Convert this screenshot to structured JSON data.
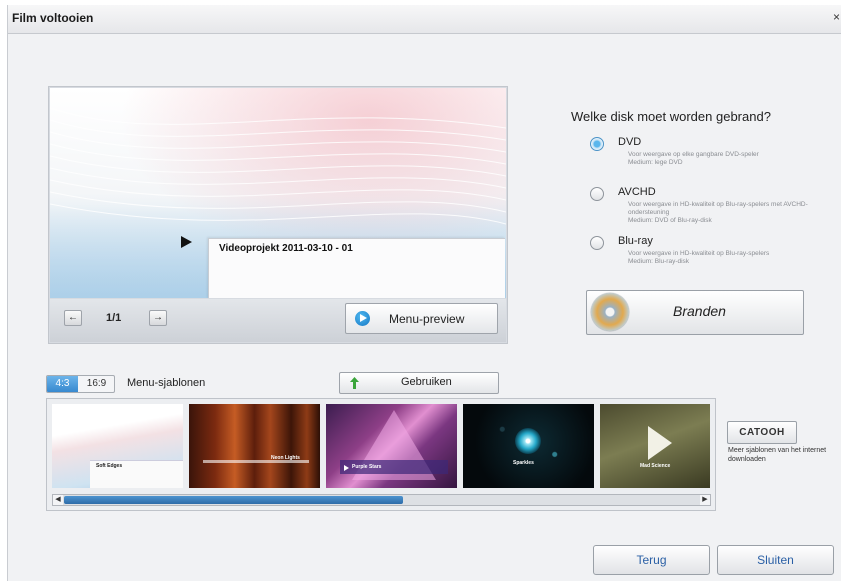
{
  "window": {
    "title": "Film voltooien",
    "close_glyph": "×"
  },
  "preview": {
    "project_title": "Videoprojekt 2011-03-10 - 01",
    "page_indicator": "1/1",
    "prev_icon": "arrow-left-icon",
    "next_icon": "arrow-right-icon",
    "menu_preview_label": "Menu-preview"
  },
  "disc": {
    "question": "Welke disk moet worden gebrand?",
    "options": [
      {
        "label": "DVD",
        "selected": true,
        "description": "Voor weergave op elke gangbare DVD-speler\nMedium: lege DVD"
      },
      {
        "label": "AVCHD",
        "selected": false,
        "description": "Voor weergave in HD-kwaliteit op Blu-ray-spelers met AVCHD-ondersteuning\nMedium: DVD of Blu-ray-disk"
      },
      {
        "label": "Blu-ray",
        "selected": false,
        "description": "Voor weergave in HD-kwaliteit op Blu-ray-spelers\nMedium: Blu-ray-disk"
      }
    ],
    "burn_label": "Branden"
  },
  "templates": {
    "aspect_options": [
      "4:3",
      "16:9"
    ],
    "aspect_selected": "4:3",
    "section_label": "Menu-sjablonen",
    "use_label": "Gebruiken",
    "items": [
      {
        "name": "Soft Edges",
        "selected": true
      },
      {
        "name": "Neon Lights",
        "selected": false
      },
      {
        "name": "Purple Stars",
        "selected": false
      },
      {
        "name": "Sparkles",
        "selected": false
      },
      {
        "name": "Mad Science",
        "selected": false
      }
    ],
    "scroll_fraction_visible": 0.52,
    "catooh_label": "CATOOH",
    "more_text": "Meer sjablonen van het internet downloaden"
  },
  "footer": {
    "back_label": "Terug",
    "close_label": "Sluiten"
  },
  "colors": {
    "accent": "#3789cf",
    "button_text": "#2a5fa5"
  }
}
